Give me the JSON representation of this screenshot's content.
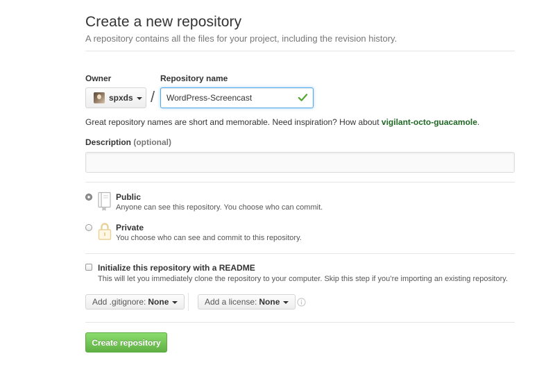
{
  "header": {
    "title": "Create a new repository",
    "subtitle": "A repository contains all the files for your project, including the revision history."
  },
  "owner": {
    "label": "Owner",
    "value": "spxds",
    "icon": "avatar"
  },
  "repo": {
    "label": "Repository name",
    "separator": "/",
    "value": "WordPress-Screencast",
    "valid_icon": "check-icon"
  },
  "hint": {
    "text": "Great repository names are short and memorable. Need inspiration? How about ",
    "suggestion": "vigilant-octo-guacamole",
    "end": "."
  },
  "description": {
    "label": "Description",
    "optional": "(optional)",
    "value": ""
  },
  "visibility": {
    "selected": "public",
    "public": {
      "title": "Public",
      "desc": "Anyone can see this repository. You choose who can commit.",
      "icon": "repo-book-icon"
    },
    "private": {
      "title": "Private",
      "desc": "You choose who can see and commit to this repository.",
      "icon": "lock-icon"
    }
  },
  "readme": {
    "label": "Initialize this repository with a README",
    "desc": "This will let you immediately clone the repository to your computer. Skip this step if you’re importing an existing repository.",
    "checked": false
  },
  "gitignore": {
    "label": "Add .gitignore:",
    "value": "None"
  },
  "license": {
    "label": "Add a license:",
    "value": "None"
  },
  "submit": {
    "label": "Create repository"
  },
  "colors": {
    "accent_blue": "#51a7e8",
    "success_green": "#55a532",
    "suggestion_green": "#1e6823",
    "button_green_top": "#8add6d",
    "button_green_bottom": "#60b044",
    "lock_yellow": "#e9d29a"
  }
}
